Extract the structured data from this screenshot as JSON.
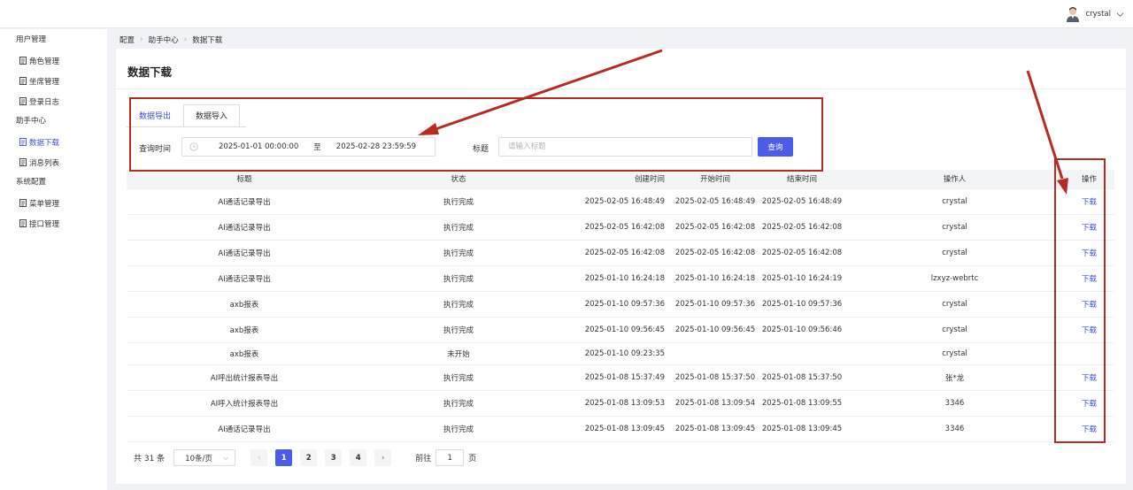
{
  "header": {
    "username": "crystal"
  },
  "sidebar": {
    "groups": [
      {
        "label": "用户管理",
        "items": [
          {
            "label": "角色管理"
          },
          {
            "label": "坐席管理"
          },
          {
            "label": "登录日志"
          }
        ]
      },
      {
        "label": "助手中心",
        "items": [
          {
            "label": "数据下载",
            "active": true
          },
          {
            "label": "消息列表"
          }
        ]
      },
      {
        "label": "系统配置",
        "items": [
          {
            "label": "菜单管理"
          },
          {
            "label": "接口管理"
          }
        ]
      }
    ]
  },
  "breadcrumb": [
    "配置",
    "助手中心",
    "数据下载"
  ],
  "page": {
    "title": "数据下载"
  },
  "tabs": [
    {
      "label": "数据导出",
      "active": true
    },
    {
      "label": "数据导入"
    }
  ],
  "filters": {
    "time_label": "查询时间",
    "start": "2025-01-01 00:00:00",
    "range_separator": "至",
    "end": "2025-02-28 23:59:59",
    "title_label": "标题",
    "title_placeholder": "请输入标题",
    "title_value": "",
    "query_label": "查询"
  },
  "table": {
    "columns": [
      "标题",
      "状态",
      "创建时间",
      "开始时间",
      "结束时间",
      "操作人",
      "操作"
    ],
    "rows": [
      [
        "AI通话记录导出",
        "执行完成",
        "2025-02-05 16:48:49",
        "2025-02-05 16:48:49",
        "2025-02-05 16:48:49",
        "crystal",
        "下载"
      ],
      [
        "AI通话记录导出",
        "执行完成",
        "2025-02-05 16:42:08",
        "2025-02-05 16:42:08",
        "2025-02-05 16:42:08",
        "crystal",
        "下载"
      ],
      [
        "AI通话记录导出",
        "执行完成",
        "2025-02-05 16:42:08",
        "2025-02-05 16:42:08",
        "2025-02-05 16:42:08",
        "crystal",
        "下载"
      ],
      [
        "AI通话记录导出",
        "执行完成",
        "2025-01-10 16:24:18",
        "2025-01-10 16:24:18",
        "2025-01-10 16:24:19",
        "lzxyz-webrtc",
        "下载"
      ],
      [
        "axb报表",
        "执行完成",
        "2025-01-10 09:57:36",
        "2025-01-10 09:57:36",
        "2025-01-10 09:57:36",
        "crystal",
        "下载"
      ],
      [
        "axb报表",
        "执行完成",
        "2025-01-10 09:56:45",
        "2025-01-10 09:56:45",
        "2025-01-10 09:56:46",
        "crystal",
        "下载"
      ],
      [
        "axb报表",
        "未开始",
        "2025-01-10 09:23:35",
        "",
        "",
        "crystal",
        ""
      ],
      [
        "AI呼出统计报表导出",
        "执行完成",
        "2025-01-08 15:37:49",
        "2025-01-08 15:37:50",
        "2025-01-08 15:37:50",
        "张*龙",
        "下载"
      ],
      [
        "AI呼入统计报表导出",
        "执行完成",
        "2025-01-08 13:09:53",
        "2025-01-08 13:09:54",
        "2025-01-08 13:09:55",
        "3346",
        "下载"
      ],
      [
        "AI通话记录导出",
        "执行完成",
        "2025-01-08 13:09:45",
        "2025-01-08 13:09:45",
        "2025-01-08 13:09:45",
        "3346",
        "下载"
      ]
    ]
  },
  "pagination": {
    "total_text": "共 31 条",
    "page_size": "10条/页",
    "pages": [
      "1",
      "2",
      "3",
      "4"
    ],
    "current_page": "1",
    "goto_label": "前往",
    "goto_value": "1",
    "page_suffix": "页"
  },
  "colors": {
    "accent": "#4c5ce8",
    "link": "#3b4dd8",
    "annotation": "#b82b22"
  }
}
